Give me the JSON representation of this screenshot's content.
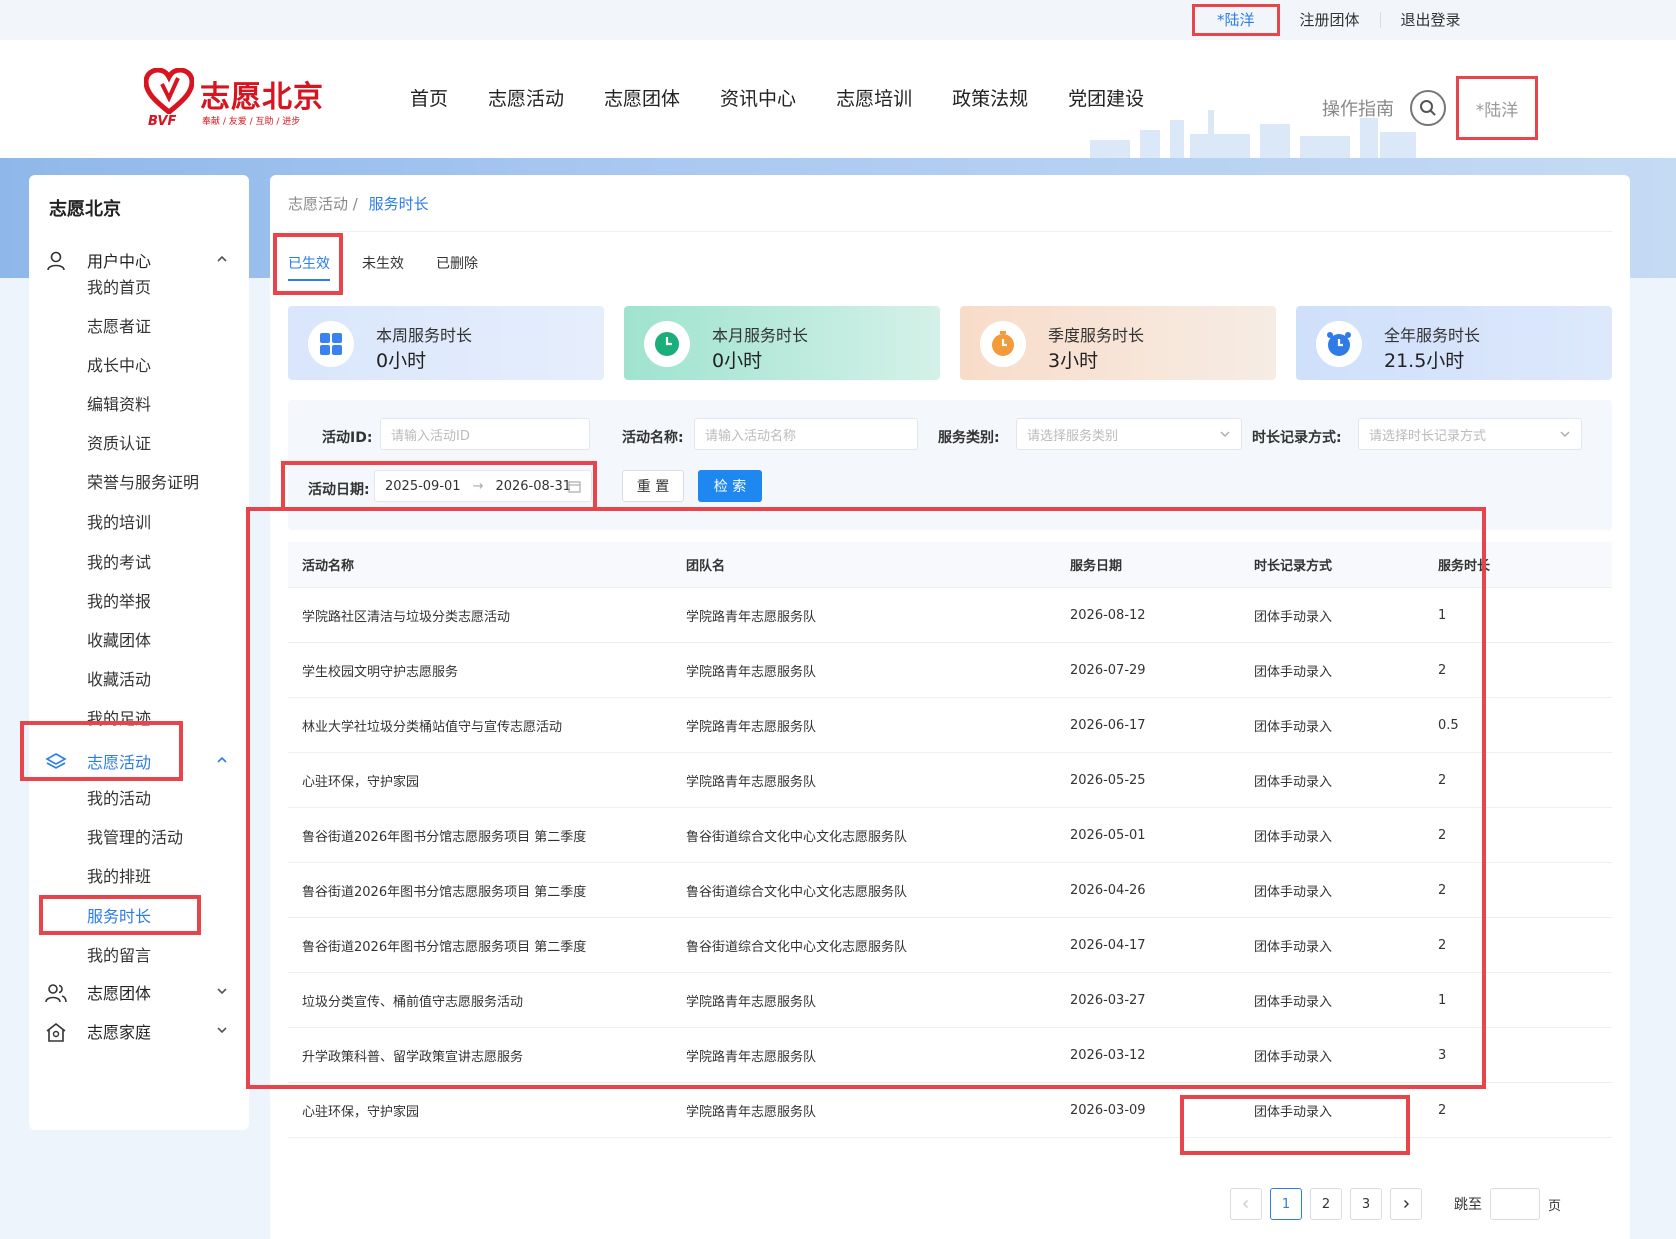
{
  "topbar": {
    "user": "*陆洋",
    "register": "注册团体",
    "logout": "退出登录"
  },
  "logo": {
    "title": "志愿北京",
    "abbr": "BVF",
    "slogan": "奉献 / 友爱 / 互助 / 进步"
  },
  "nav": [
    "首页",
    "志愿活动",
    "志愿团体",
    "资讯中心",
    "志愿培训",
    "政策法规",
    "党团建设"
  ],
  "header": {
    "guide": "操作指南",
    "user": "*陆洋"
  },
  "sidebar": {
    "title": "志愿北京",
    "user_center": "用户中心",
    "user_items": [
      "我的首页",
      "志愿者证",
      "成长中心",
      "编辑资料",
      "资质认证",
      "荣誉与服务证明",
      "我的培训",
      "我的考试",
      "我的举报",
      "收藏团体",
      "收藏活动",
      "我的足迹"
    ],
    "activity": "志愿活动",
    "activity_items": [
      "我的活动",
      "我管理的活动",
      "我的排班",
      "服务时长",
      "我的留言"
    ],
    "team": "志愿团体",
    "family": "志愿家庭"
  },
  "breadcrumb": {
    "parent": "志愿活动 /",
    "current": "服务时长"
  },
  "tabs": [
    "已生效",
    "未生效",
    "已删除"
  ],
  "stats": [
    {
      "label": "本周服务时长",
      "value": "0小时",
      "icon": "grid-icon"
    },
    {
      "label": "本月服务时长",
      "value": "0小时",
      "icon": "clock-icon"
    },
    {
      "label": "季度服务时长",
      "value": "3小时",
      "icon": "stopwatch-icon"
    },
    {
      "label": "全年服务时长",
      "value": "21.5小时",
      "icon": "alarm-clock-icon"
    }
  ],
  "filter": {
    "activity_id_label": "活动ID:",
    "activity_id_placeholder": "请输入活动ID",
    "activity_name_label": "活动名称:",
    "activity_name_placeholder": "请输入活动名称",
    "category_label": "服务类别:",
    "category_placeholder": "请选择服务类别",
    "record_label": "时长记录方式:",
    "record_placeholder": "请选择时长记录方式",
    "date_label": "活动日期:",
    "date_start": "2025-09-01",
    "date_sep": "→",
    "date_end": "2026-08-31",
    "reset": "重 置",
    "search": "检 索"
  },
  "table": {
    "headers": [
      "活动名称",
      "团队名",
      "服务日期",
      "时长记录方式",
      "服务时长"
    ],
    "rows": [
      [
        "学院路社区清洁与垃圾分类志愿活动",
        "学院路青年志愿服务队",
        "2026-08-12",
        "团体手动录入",
        "1"
      ],
      [
        "学生校园文明守护志愿服务",
        "学院路青年志愿服务队",
        "2026-07-29",
        "团体手动录入",
        "2"
      ],
      [
        "林业大学社垃圾分类桶站值守与宣传志愿活动",
        "学院路青年志愿服务队",
        "2026-06-17",
        "团体手动录入",
        "0.5"
      ],
      [
        "心驻环保，守护家园",
        "学院路青年志愿服务队",
        "2026-05-25",
        "团体手动录入",
        "2"
      ],
      [
        "鲁谷街道2026年图书分馆志愿服务项目 第二季度",
        "鲁谷街道综合文化中心文化志愿服务队",
        "2026-05-01",
        "团体手动录入",
        "2"
      ],
      [
        "鲁谷街道2026年图书分馆志愿服务项目 第二季度",
        "鲁谷街道综合文化中心文化志愿服务队",
        "2026-04-26",
        "团体手动录入",
        "2"
      ],
      [
        "鲁谷街道2026年图书分馆志愿服务项目 第二季度",
        "鲁谷街道综合文化中心文化志愿服务队",
        "2026-04-17",
        "团体手动录入",
        "2"
      ],
      [
        "垃圾分类宣传、桶前值守志愿服务活动",
        "学院路青年志愿服务队",
        "2026-03-27",
        "团体手动录入",
        "1"
      ],
      [
        "升学政策科普、留学政策宣讲志愿服务",
        "学院路青年志愿服务队",
        "2026-03-12",
        "团体手动录入",
        "3"
      ],
      [
        "心驻环保，守护家园",
        "学院路青年志愿服务队",
        "2026-03-09",
        "团体手动录入",
        "2"
      ]
    ]
  },
  "pager": {
    "pages": [
      "1",
      "2",
      "3"
    ],
    "current": "1",
    "jump_label": "跳至",
    "page_suffix": "页"
  },
  "colors": {
    "accent": "#2b7de9",
    "brand": "#d7141f",
    "highlight": "#e8444c"
  }
}
